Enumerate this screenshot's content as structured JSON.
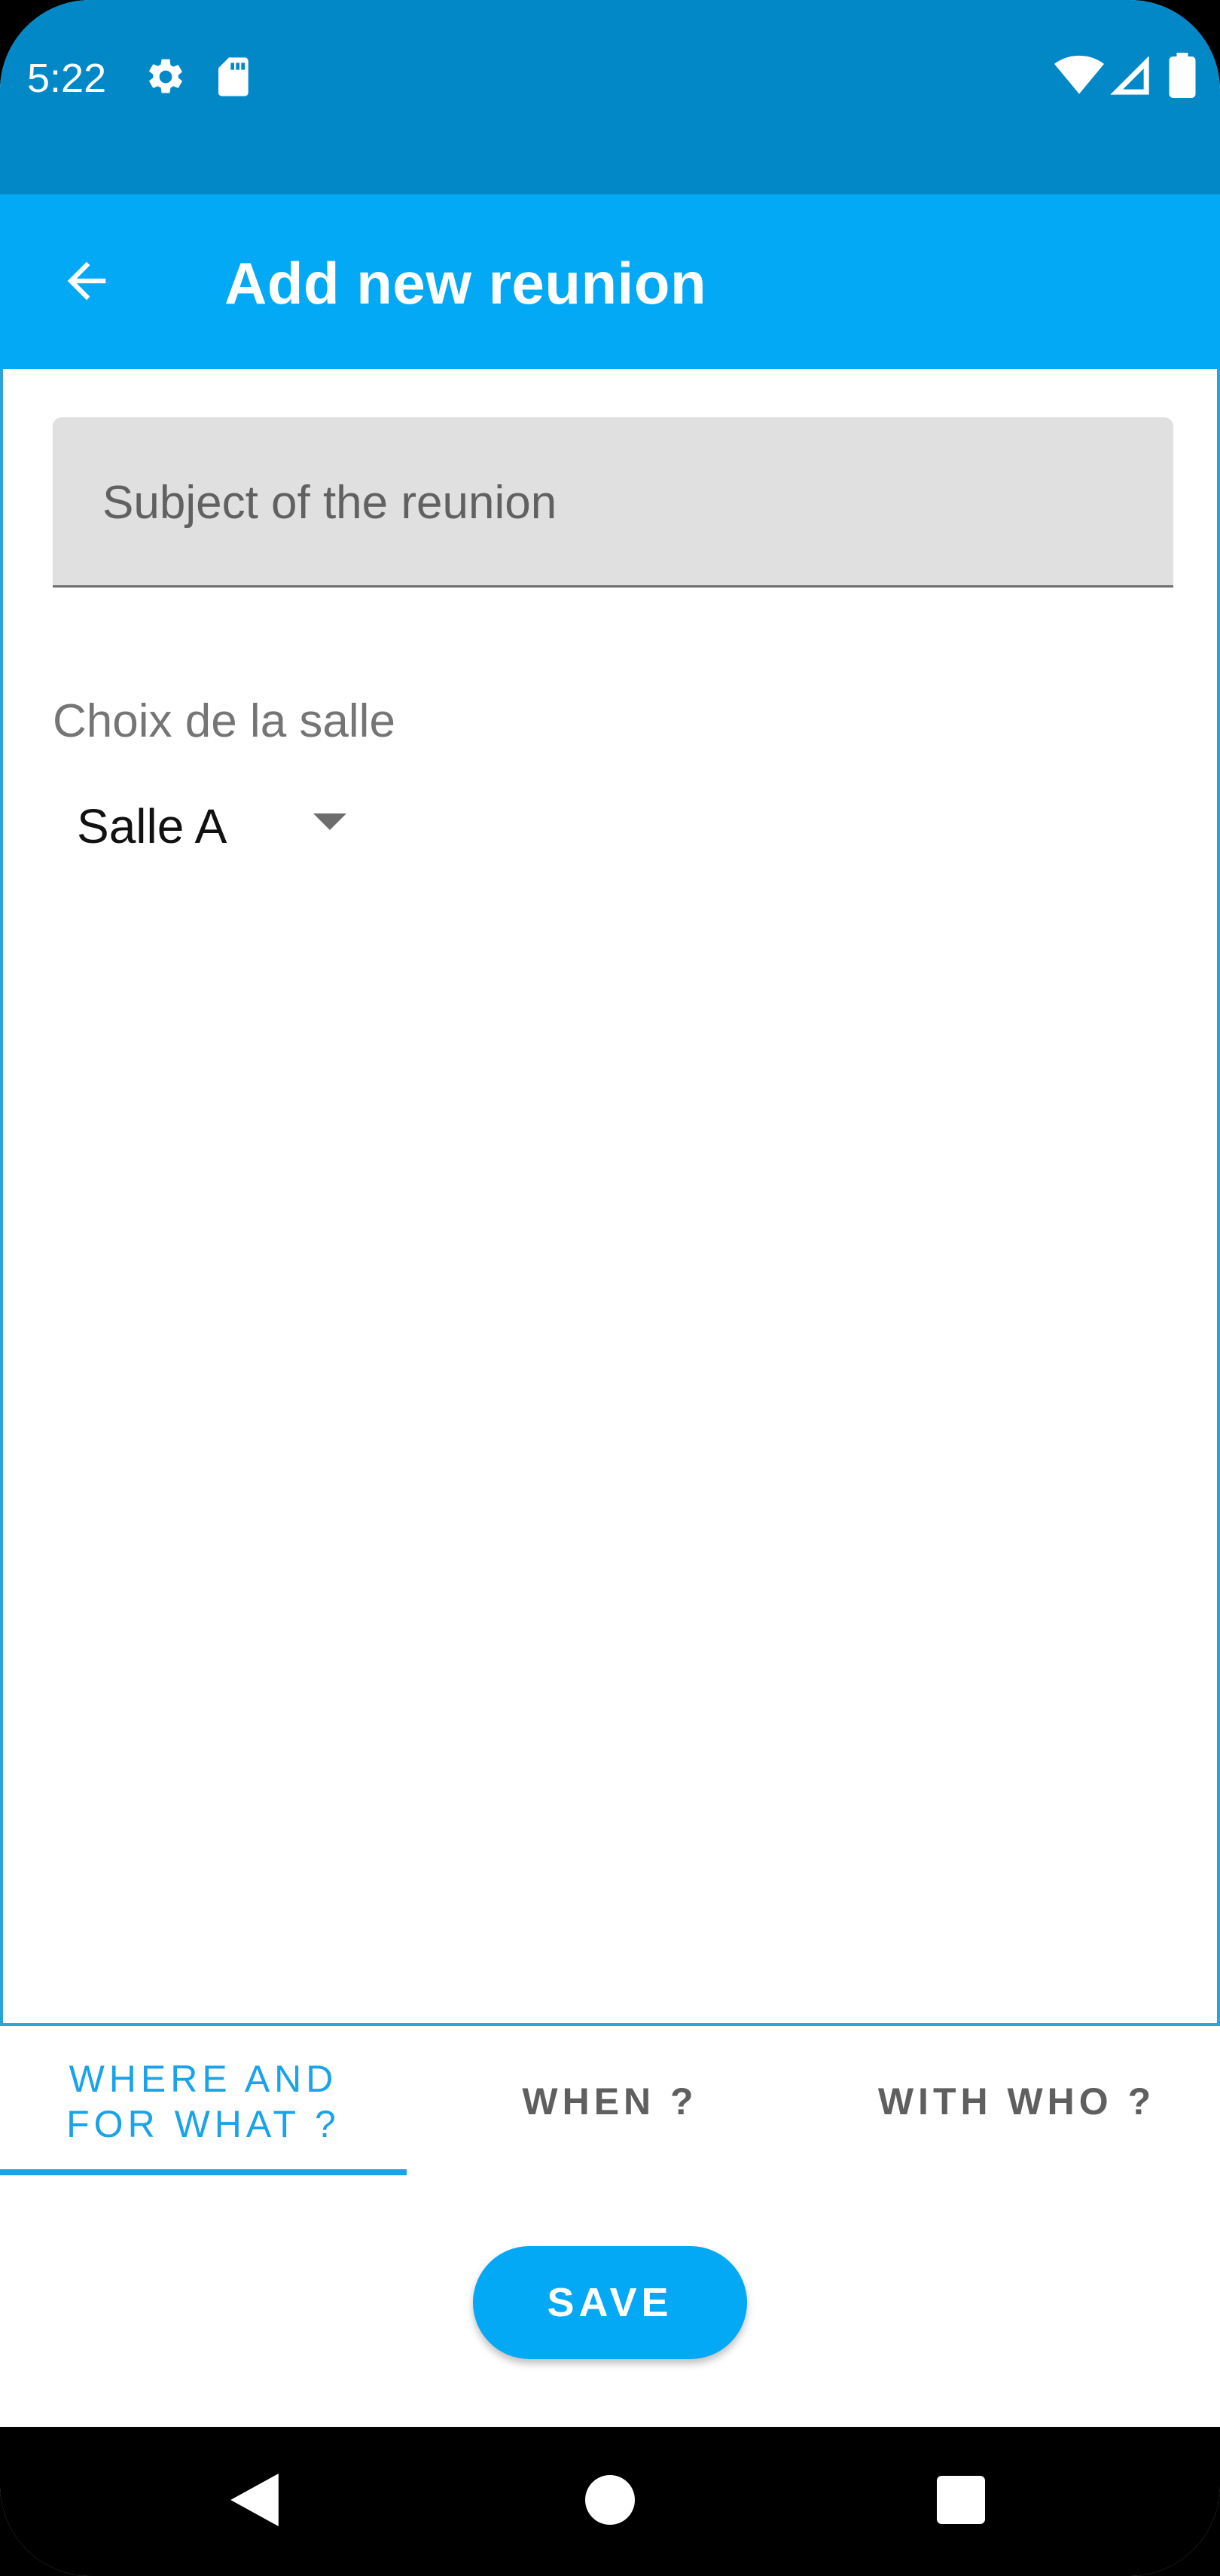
{
  "status_bar": {
    "time": "5:22",
    "background": "#0288c7",
    "icons": [
      "gear-icon",
      "sd-card-icon",
      "wifi-icon",
      "signal-icon",
      "battery-icon"
    ]
  },
  "app_bar": {
    "title": "Add new reunion",
    "background": "#03a9f4",
    "back_icon": "arrow-left-icon"
  },
  "form": {
    "subject": {
      "value": "",
      "placeholder": "Subject of the reunion"
    },
    "room": {
      "label": "Choix de la salle",
      "selected": "Salle A"
    }
  },
  "tabs": {
    "items": [
      {
        "label": "WHERE AND\nFOR WHAT ?",
        "active": true
      },
      {
        "label": "WHEN ?",
        "active": false
      },
      {
        "label": "WITH WHO ?",
        "active": false
      }
    ],
    "accent": "#1aa3e8"
  },
  "actions": {
    "save_label": "SAVE"
  },
  "nav_bar": {
    "icons": [
      "back-triangle-icon",
      "home-circle-icon",
      "recents-square-icon"
    ]
  }
}
